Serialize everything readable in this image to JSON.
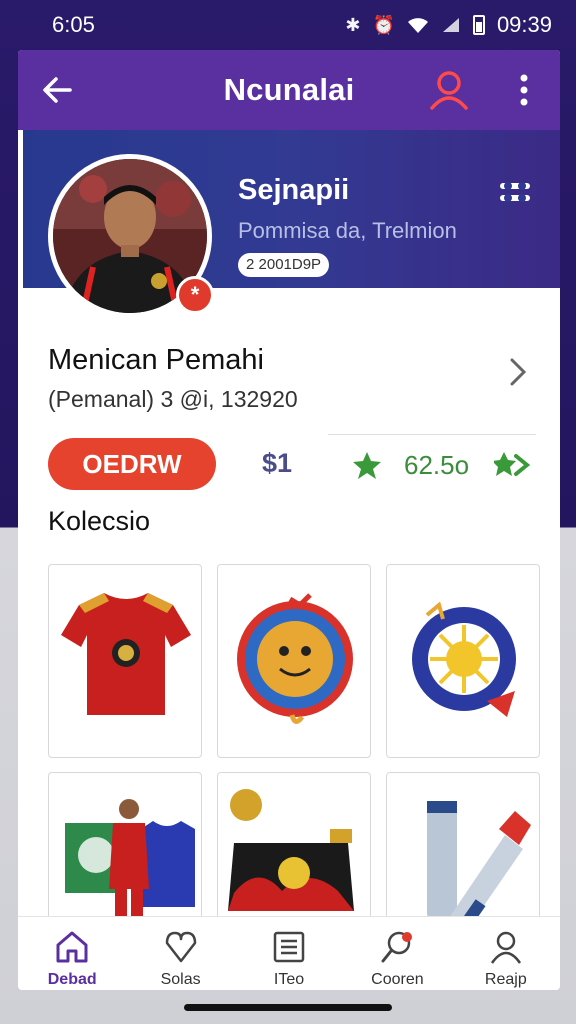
{
  "status_bar": {
    "time": "6:05",
    "clock_right": "09:39",
    "icons": [
      "bluetooth-icon",
      "alarm-icon",
      "wifi-icon",
      "signal-icon",
      "battery-icon"
    ]
  },
  "app_bar": {
    "title": "Ncunalai",
    "icons": [
      "back-arrow-icon",
      "profile-icon",
      "more-vertical-icon"
    ]
  },
  "hero": {
    "name": "Sejnapii",
    "subtitle": "Pommisa da, Trelmion",
    "chip": "2 2001D9P"
  },
  "seller": {
    "name": "Menican Pemahi",
    "meta": "(Pemanal) 3 @i, 132920"
  },
  "actions": {
    "order_button": "OEDRW",
    "price": "$1",
    "rating": "62.5o"
  },
  "collection": {
    "title": "Kolecsio",
    "items": [
      "red-jersey",
      "badge-medal",
      "sun-emblem",
      "player-with-jersey",
      "black-pouch",
      "silver-tool"
    ]
  },
  "bottom_nav": [
    {
      "label": "Debad",
      "icon": "home-icon",
      "active": true
    },
    {
      "label": "Solas",
      "icon": "heart-icon",
      "active": false
    },
    {
      "label": "ITeo",
      "icon": "list-icon",
      "active": false
    },
    {
      "label": "Cooren",
      "icon": "search-icon",
      "active": false
    },
    {
      "label": "Reajp",
      "icon": "person-icon",
      "active": false
    }
  ],
  "colors": {
    "accent": "#5a2fa0",
    "hero": "#2f3a90",
    "order": "#e5432e",
    "rating": "#3c8c3c"
  }
}
